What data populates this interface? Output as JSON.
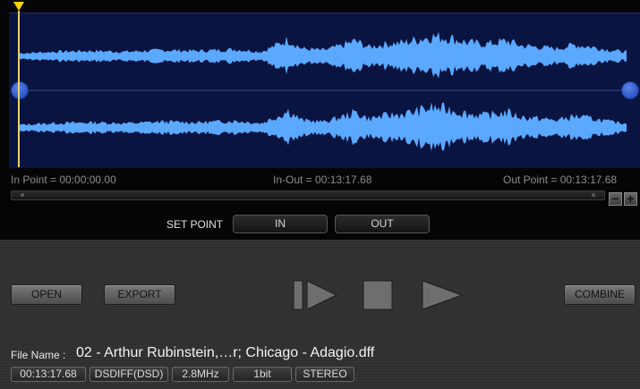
{
  "info": {
    "in_point": "In Point = 00:00:00.00",
    "in_out": "In-Out = 00:13:17.68",
    "out_point": "Out Point = 00:13:17.68"
  },
  "zoom": {
    "minus": "−",
    "plus": "+"
  },
  "set_point": {
    "label": "SET POINT",
    "in": "IN",
    "out": "OUT"
  },
  "buttons": {
    "open": "OPEN",
    "export": "EXPORT",
    "combine": "COMBINE"
  },
  "transport": {
    "prev_icon": "skip-to-start-icon",
    "stop_icon": "stop-icon",
    "play_icon": "play-icon"
  },
  "file": {
    "label": "File Name :",
    "name": "02 - Arthur Rubinstein,…r; Chicago - Adagio.dff"
  },
  "badges": {
    "duration": "00:13:17.68",
    "format": "DSDIFF(DSD)",
    "sample_rate": "2.8MHz",
    "bit_depth": "1bit",
    "channels": "STEREO"
  },
  "colors": {
    "waveform_bg": "#0a1440",
    "waveform": "#5aa8ff",
    "playhead": "#f5d400",
    "panel": "#2f2f2f"
  }
}
